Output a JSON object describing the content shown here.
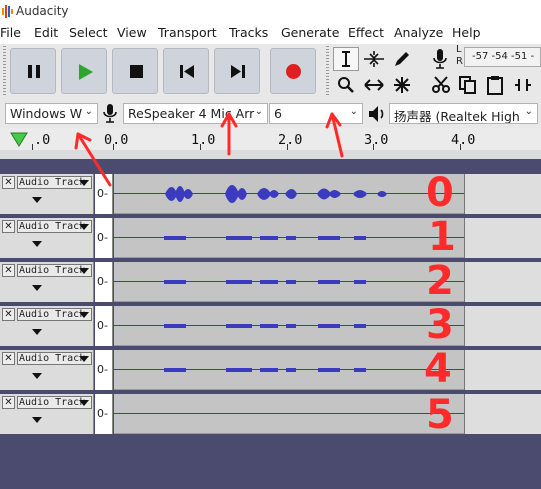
{
  "window": {
    "title": "Audacity"
  },
  "menu": [
    "File",
    "Edit",
    "Select",
    "View",
    "Transport",
    "Tracks",
    "Generate",
    "Effect",
    "Analyze",
    "Help"
  ],
  "meter": {
    "l_label": "L",
    "r_label": "R",
    "scale": "-57 -54 -51 -"
  },
  "device_bar": {
    "host": "Windows W",
    "recording_device": "ReSpeaker 4 Mic Arr",
    "channels": "6",
    "playback_device": "扬声器 (Realtek High"
  },
  "ruler": {
    "labels": [
      ".0",
      "0.0",
      "1.0",
      "2.0",
      "3.0",
      "4.0"
    ]
  },
  "tracks": [
    {
      "name": "Audio Track",
      "scale": "0-",
      "annotation": "0"
    },
    {
      "name": "Audio Track",
      "scale": "0-",
      "annotation": "1"
    },
    {
      "name": "Audio Track",
      "scale": "0-",
      "annotation": "2"
    },
    {
      "name": "Audio Track",
      "scale": "0-",
      "annotation": "3"
    },
    {
      "name": "Audio Track",
      "scale": "0-",
      "annotation": "4"
    },
    {
      "name": "Audio Track",
      "scale": "0-",
      "annotation": "5"
    }
  ],
  "colors": {
    "accent_play": "#2fa52f",
    "record": "#e02020",
    "waveform": "#3b3bbf",
    "annotation": "#ff2b2b"
  },
  "icons": [
    "pause-icon",
    "play-icon",
    "stop-icon",
    "skip-start-icon",
    "skip-end-icon",
    "record-icon",
    "selection-tool-icon",
    "envelope-tool-icon",
    "draw-tool-icon",
    "zoom-tool-icon",
    "timeshift-tool-icon",
    "multi-tool-icon",
    "cut-icon",
    "copy-icon",
    "paste-icon",
    "microphone-icon",
    "speaker-icon"
  ]
}
